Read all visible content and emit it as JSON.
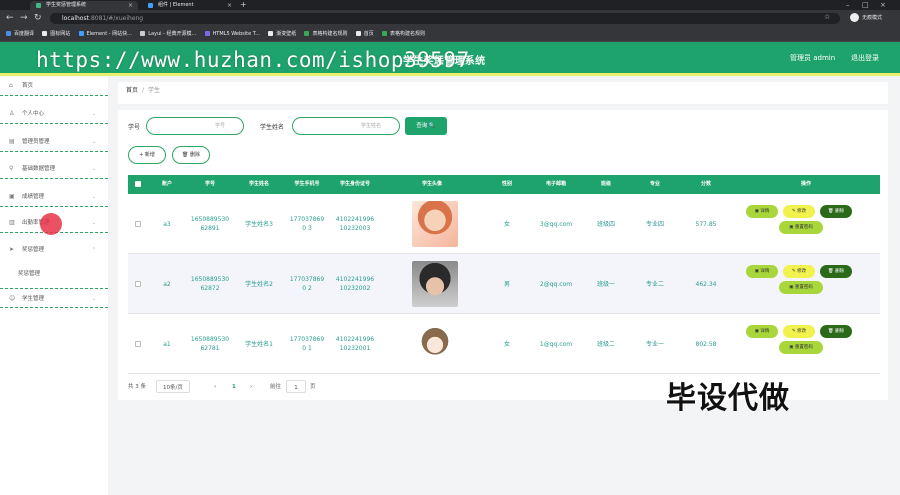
{
  "browser": {
    "tabs": [
      {
        "title": "学生奖惩管理系统",
        "active": true
      },
      {
        "title": "组件 | Element",
        "active": false
      }
    ],
    "url_host": "localhost",
    "url_rest": ":8081/#/xueiheng",
    "profile": "无痕模式",
    "bookmarks": [
      "百度翻译",
      "图标网站",
      "Element - 网站快...",
      "Layui - 经典开源模...",
      "HTML5 Website T...",
      "渐变壁纸",
      "表格构建名规则",
      "首页",
      "表格构建名规则"
    ]
  },
  "header": {
    "title": "学生奖惩管理系统",
    "admin": "管理员 admin",
    "logout": "退出登录",
    "watermark": "https://www.huzhan.com/ishop39597"
  },
  "sidebar": {
    "items": [
      {
        "label": "首页",
        "icon": "home-icon",
        "glyph": "⌂"
      },
      {
        "label": "个人中心",
        "icon": "user-icon",
        "glyph": "♙"
      },
      {
        "label": "管理员管理",
        "icon": "admin-icon",
        "glyph": "▤"
      },
      {
        "label": "基础数据管理",
        "icon": "data-icon",
        "glyph": "⚲"
      },
      {
        "label": "成绩管理",
        "icon": "score-icon",
        "glyph": "▣"
      },
      {
        "label": "出勤率管理",
        "icon": "chart-icon",
        "glyph": "▥"
      },
      {
        "label": "奖惩管理",
        "icon": "send-icon",
        "glyph": "➤"
      },
      {
        "label": "学生管理",
        "icon": "student-icon",
        "glyph": "☺"
      }
    ],
    "sub_item": "奖惩管理"
  },
  "breadcrumb": {
    "home": "首页",
    "sep": "/",
    "current": "学生"
  },
  "search": {
    "label1": "学号",
    "placeholder1": "学号",
    "label2": "学生姓名",
    "placeholder2": "学生姓名",
    "query": "查询 🔍"
  },
  "actions": {
    "add": "+ 新增",
    "delete": "🗑 删除"
  },
  "table": {
    "headers": [
      "账户",
      "学号",
      "学生姓名",
      "学生手机号",
      "学生身份证号",
      "学生头像",
      "性别",
      "电子邮箱",
      "班级",
      "专业",
      "分数",
      "操作"
    ],
    "rows": [
      {
        "account": "a3",
        "no": "1650889530 62891",
        "name": "学生姓名3",
        "phone": "1770378690 3",
        "idcard": "4102241996 10232003",
        "gender": "女",
        "email": "3@qq.com",
        "class": "班级四",
        "major": "专业四",
        "score": "577.85"
      },
      {
        "account": "a2",
        "no": "1650889530 62872",
        "name": "学生姓名2",
        "phone": "1770378690 2",
        "idcard": "4102241996 10232002",
        "gender": "男",
        "email": "2@qq.com",
        "class": "班级一",
        "major": "专业二",
        "score": "462.34"
      },
      {
        "account": "a1",
        "no": "1650889530 62781",
        "name": "学生姓名1",
        "phone": "1770378690 1",
        "idcard": "4102241996 10232001",
        "gender": "女",
        "email": "1@qq.com",
        "class": "班级二",
        "major": "专业一",
        "score": "802.58"
      }
    ],
    "row_buttons": {
      "detail": "▣ 详情",
      "edit": "✎ 修改",
      "delete": "🗑 删除",
      "reset": "▣ 重置密码"
    }
  },
  "pager": {
    "total": "共 3 条",
    "size": "10条/页",
    "prev": "‹",
    "page": "1",
    "next": "›",
    "goto": "前往",
    "goto_val": "1",
    "page_unit": "页"
  },
  "overlay": "毕设代做",
  "colors": {
    "primary": "#1fa36c",
    "accent_line": "#e9f06b",
    "detail": "#a8d63b",
    "edit": "#f2f24f",
    "delete": "#2a6a19"
  }
}
